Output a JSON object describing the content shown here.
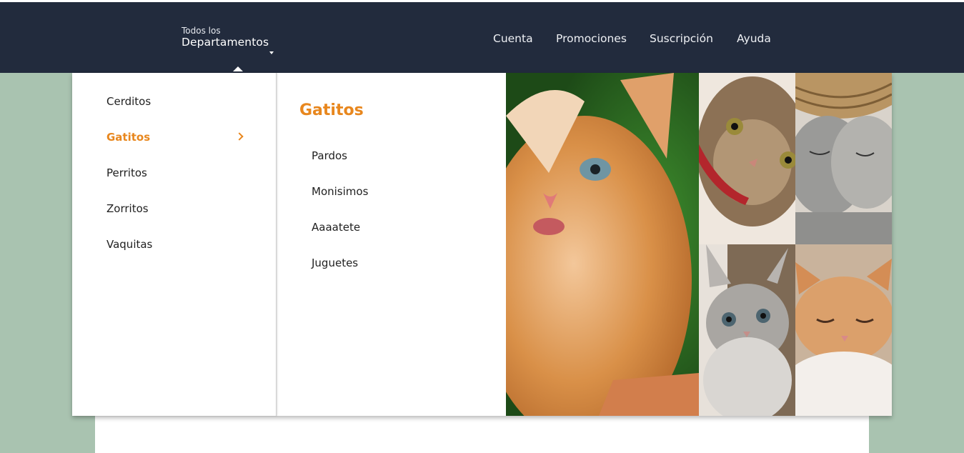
{
  "header": {
    "dept_small": "Todos los",
    "dept_big": "Departamentos",
    "nav": [
      "Cuenta",
      "Promociones",
      "Suscripción",
      "Ayuda"
    ]
  },
  "menu": {
    "categories": [
      "Cerditos",
      "Gatitos",
      "Perritos",
      "Zorritos",
      "Vaquitas"
    ],
    "active_category": "Gatitos",
    "submenu_title": "Gatitos",
    "subitems": [
      "Pardos",
      "Monisimos",
      "Aaaatete",
      "Juguetes"
    ]
  },
  "colors": {
    "header_bg": "#222b3d",
    "accent": "#e8871e",
    "page_bg": "#a9c3b0"
  }
}
